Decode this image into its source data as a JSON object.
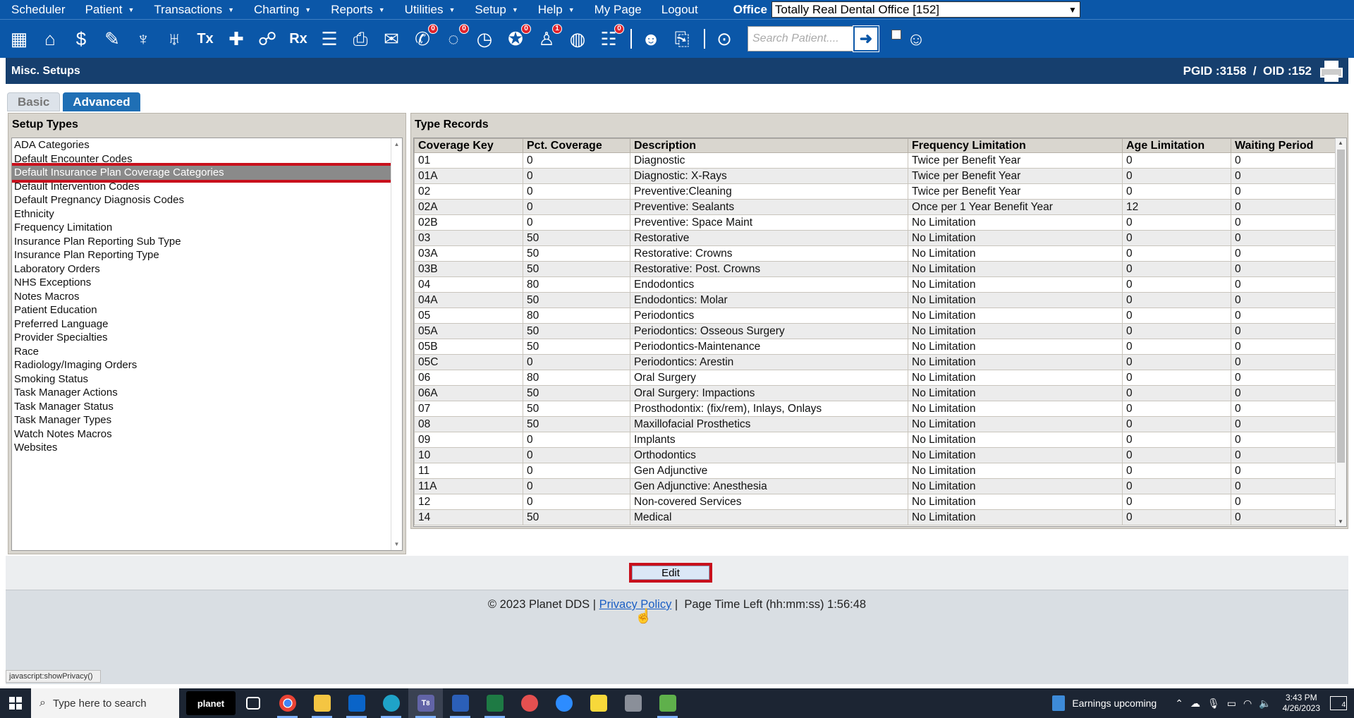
{
  "menu": {
    "items": [
      {
        "label": "Scheduler",
        "caret": false
      },
      {
        "label": "Patient",
        "caret": true
      },
      {
        "label": "Transactions",
        "caret": true
      },
      {
        "label": "Charting",
        "caret": true
      },
      {
        "label": "Reports",
        "caret": true
      },
      {
        "label": "Utilities",
        "caret": true
      },
      {
        "label": "Setup",
        "caret": true
      },
      {
        "label": "Help",
        "caret": true
      },
      {
        "label": "My Page",
        "caret": false
      },
      {
        "label": "Logout",
        "caret": false
      }
    ],
    "office_label": "Office",
    "office_value": "Totally Real Dental Office [152]"
  },
  "toolbar": {
    "badges": {
      "messages": "0",
      "chat": "0",
      "alerts": "0",
      "people": "1",
      "tasks": "0"
    },
    "search_placeholder": "Search Patient...."
  },
  "title": {
    "left": "Misc. Setups",
    "right": "PGID :3158  /  OID :152"
  },
  "tabs": {
    "basic": "Basic",
    "advanced": "Advanced"
  },
  "setup_types": {
    "header": "Setup Types",
    "selected": 2,
    "items": [
      "ADA Categories",
      "Default Encounter Codes",
      "Default Insurance Plan Coverage Categories",
      "Default Intervention Codes",
      "Default Pregnancy Diagnosis Codes",
      "Ethnicity",
      "Frequency Limitation",
      "Insurance Plan Reporting Sub Type",
      "Insurance Plan Reporting Type",
      "Laboratory Orders",
      "NHS Exceptions",
      "Notes Macros",
      "Patient Education",
      "Preferred Language",
      "Provider Specialties",
      "Race",
      "Radiology/Imaging Orders",
      "Smoking Status",
      "Task Manager Actions",
      "Task Manager Status",
      "Task Manager Types",
      "Watch Notes Macros",
      "Websites"
    ]
  },
  "type_records": {
    "header": "Type Records",
    "columns": [
      "Coverage Key",
      "Pct. Coverage",
      "Description",
      "Frequency Limitation",
      "Age Limitation",
      "Waiting Period"
    ],
    "rows": [
      [
        "01",
        "0",
        "Diagnostic",
        "Twice per Benefit Year",
        "0",
        "0"
      ],
      [
        "01A",
        "0",
        "Diagnostic: X-Rays",
        "Twice per Benefit Year",
        "0",
        "0"
      ],
      [
        "02",
        "0",
        "Preventive:Cleaning",
        "Twice per Benefit Year",
        "0",
        "0"
      ],
      [
        "02A",
        "0",
        "Preventive: Sealants",
        "Once per 1 Year Benefit Year",
        "12",
        "0"
      ],
      [
        "02B",
        "0",
        "Preventive: Space Maint",
        "No Limitation",
        "0",
        "0"
      ],
      [
        "03",
        "50",
        "Restorative",
        "No Limitation",
        "0",
        "0"
      ],
      [
        "03A",
        "50",
        "Restorative: Crowns",
        "No Limitation",
        "0",
        "0"
      ],
      [
        "03B",
        "50",
        "Restorative: Post. Crowns",
        "No Limitation",
        "0",
        "0"
      ],
      [
        "04",
        "80",
        "Endodontics",
        "No Limitation",
        "0",
        "0"
      ],
      [
        "04A",
        "50",
        "Endodontics: Molar",
        "No Limitation",
        "0",
        "0"
      ],
      [
        "05",
        "80",
        "Periodontics",
        "No Limitation",
        "0",
        "0"
      ],
      [
        "05A",
        "50",
        "Periodontics: Osseous Surgery",
        "No Limitation",
        "0",
        "0"
      ],
      [
        "05B",
        "50",
        "Periodontics-Maintenance",
        "No Limitation",
        "0",
        "0"
      ],
      [
        "05C",
        "0",
        "Periodontics: Arestin",
        "No Limitation",
        "0",
        "0"
      ],
      [
        "06",
        "80",
        "Oral Surgery",
        "No Limitation",
        "0",
        "0"
      ],
      [
        "06A",
        "50",
        "Oral Surgery: Impactions",
        "No Limitation",
        "0",
        "0"
      ],
      [
        "07",
        "50",
        "Prosthodontix: (fix/rem), Inlays, Onlays",
        "No Limitation",
        "0",
        "0"
      ],
      [
        "08",
        "50",
        "Maxillofacial Prosthetics",
        "No Limitation",
        "0",
        "0"
      ],
      [
        "09",
        "0",
        "Implants",
        "No Limitation",
        "0",
        "0"
      ],
      [
        "10",
        "0",
        "Orthodontics",
        "No Limitation",
        "0",
        "0"
      ],
      [
        "11",
        "0",
        "Gen Adjunctive",
        "No Limitation",
        "0",
        "0"
      ],
      [
        "11A",
        "0",
        "Gen Adjunctive: Anesthesia",
        "No Limitation",
        "0",
        "0"
      ],
      [
        "12",
        "0",
        "Non-covered Services",
        "No Limitation",
        "0",
        "0"
      ],
      [
        "14",
        "50",
        "Medical",
        "No Limitation",
        "0",
        "0"
      ]
    ]
  },
  "edit_button": "Edit",
  "footer": {
    "copyright": "© 2023 Planet DDS |",
    "privacy": "Privacy Policy",
    "time_left": "|  Page Time Left (hh:mm:ss) 1:56:48"
  },
  "status_url": "javascript:showPrivacy()",
  "taskbar": {
    "search_placeholder": "Type here to search",
    "planet_label": "planet",
    "teams_badge": "8",
    "news": "Earnings upcoming",
    "time": "3:43 PM",
    "date": "4/26/2023",
    "notifications": "4"
  },
  "colors": {
    "brand": "#0b57a8",
    "header": "#163f6e",
    "highlight": "#c8101c"
  }
}
